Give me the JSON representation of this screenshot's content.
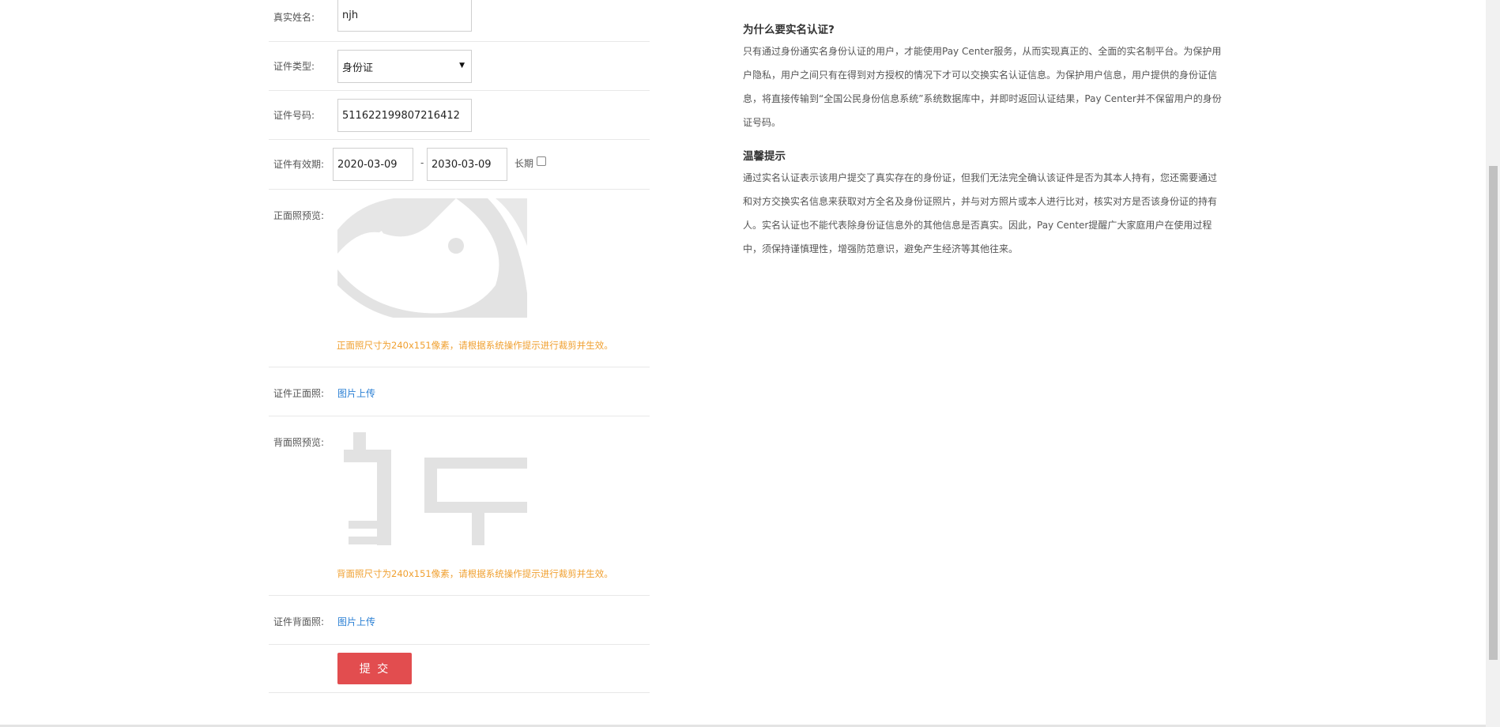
{
  "form": {
    "real_name": {
      "label": "真实姓名:",
      "value": "njh"
    },
    "id_type": {
      "label": "证件类型:",
      "value": "身份证"
    },
    "id_number": {
      "label": "证件号码:",
      "value": "511622199807216412"
    },
    "validity": {
      "label": "证件有效期:",
      "start": "2020-03-09",
      "separator": "-",
      "end": "2030-03-09",
      "long_term_label": "长期",
      "long_term_checked": false
    },
    "front_preview": {
      "label": "正面照预览:",
      "hint": "正面照尺寸为240x151像素，请根据系统操作提示进行裁剪并生效。"
    },
    "front_upload": {
      "label": "证件正面照:",
      "link": "图片上传"
    },
    "back_preview": {
      "label": "背面照预览:",
      "hint": "背面照尺寸为240x151像素，请根据系统操作提示进行裁剪并生效。"
    },
    "back_upload": {
      "label": "证件背面照:",
      "link": "图片上传"
    },
    "submit_label": "提 交"
  },
  "info": {
    "why_title": "为什么要实名认证?",
    "why_text": "只有通过身份通实名身份认证的用户，才能使用Pay Center服务，从而实现真正的、全面的实名制平台。为保护用户隐私，用户之间只有在得到对方授权的情况下才可以交换实名认证信息。为保护用户信息，用户提供的身份证信息，将直接传输到“全国公民身份信息系统”系统数据库中，并即时返回认证结果，Pay Center并不保留用户的身份证号码。",
    "tips_title": "温馨提示",
    "tips_text": "通过实名认证表示该用户提交了真实存在的身份证，但我们无法完全确认该证件是否为其本人持有，您还需要通过和对方交换实名信息来获取对方全名及身份证照片，并与对方照片或本人进行比对，核实对方是否该身份证的持有人。实名认证也不能代表除身份证信息外的其他信息是否真实。因此，Pay Center提醒广大家庭用户在使用过程中，须保持谨慎理性，增强防范意识，避免产生经济等其他往来。"
  },
  "colors": {
    "accent_red": "#e24d4f",
    "hint_orange": "#f0a030",
    "link_blue": "#2a7fd4"
  }
}
